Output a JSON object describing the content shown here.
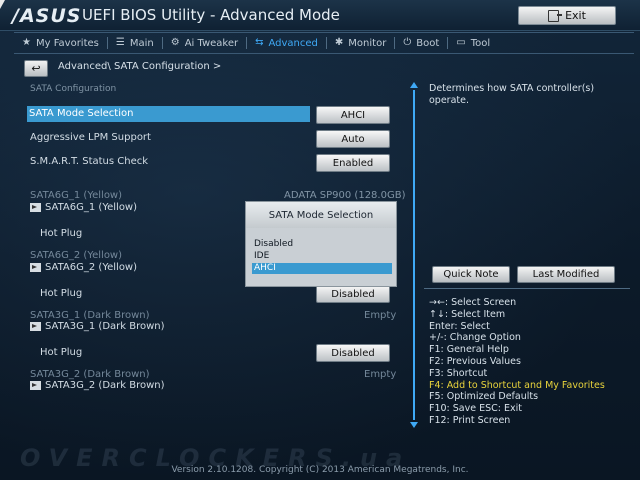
{
  "header": {
    "logo": "/ASUS",
    "title": "UEFI BIOS Utility - Advanced Mode",
    "exit_label": "Exit"
  },
  "tabs": [
    {
      "label": "My Favorites",
      "icon": "star-icon"
    },
    {
      "label": "Main",
      "icon": "list-icon"
    },
    {
      "label": "Ai Tweaker",
      "icon": "tweaker-icon"
    },
    {
      "label": "Advanced",
      "icon": "advanced-icon",
      "active": true
    },
    {
      "label": "Monitor",
      "icon": "gear-icon"
    },
    {
      "label": "Boot",
      "icon": "power-icon"
    },
    {
      "label": "Tool",
      "icon": "tool-icon"
    }
  ],
  "breadcrumb": "Advanced\\ SATA Configuration >",
  "main": {
    "section_title": "SATA Configuration",
    "sata_mode": {
      "label": "SATA Mode Selection",
      "value": "AHCI"
    },
    "aggressive_lpm": {
      "label": "Aggressive LPM Support",
      "value": "Auto"
    },
    "smart": {
      "label": "S.M.A.R.T. Status Check",
      "value": "Enabled"
    },
    "ports": [
      {
        "header": "SATA6G_1 (Yellow)",
        "device": "ADATA SP900 (128.0GB)",
        "sub": "SATA6G_1 (Yellow)",
        "hotplug_label": "Hot Plug",
        "hotplug_value": ""
      },
      {
        "header": "SATA6G_2 (Yellow)",
        "device": "",
        "sub": "SATA6G_2 (Yellow)",
        "hotplug_label": "Hot Plug",
        "hotplug_value": "Disabled"
      },
      {
        "header": "SATA3G_1 (Dark Brown)",
        "device": "Empty",
        "sub": "SATA3G_1 (Dark Brown)",
        "hotplug_label": "Hot Plug",
        "hotplug_value": "Disabled"
      },
      {
        "header": "SATA3G_2 (Dark Brown)",
        "device": "Empty",
        "sub": "SATA3G_2 (Dark Brown)"
      }
    ]
  },
  "popup": {
    "title": "SATA Mode Selection",
    "options": [
      "Disabled",
      "IDE",
      "AHCI"
    ],
    "selected": "AHCI"
  },
  "help": {
    "text": "Determines how SATA controller(s) operate."
  },
  "right_buttons": {
    "quick_note": "Quick Note",
    "last_modified": "Last Modified"
  },
  "keys": [
    "→←: Select Screen",
    "↑↓: Select Item",
    "Enter: Select",
    "+/-: Change Option",
    "F1: General Help",
    "F2: Previous Values",
    "F3: Shortcut",
    "F4: Add to Shortcut and My Favorites",
    "F5: Optimized Defaults",
    "F10: Save  ESC: Exit",
    "F12: Print Screen"
  ],
  "watermark": "OVERCLOCKERS.ua",
  "footer": "Version 2.10.1208. Copyright (C) 2013 American Megatrends, Inc.",
  "colors": {
    "accent": "#3fa9f5",
    "highlight": "#3a9ad0",
    "shortcut_key": "#e8d33c"
  }
}
